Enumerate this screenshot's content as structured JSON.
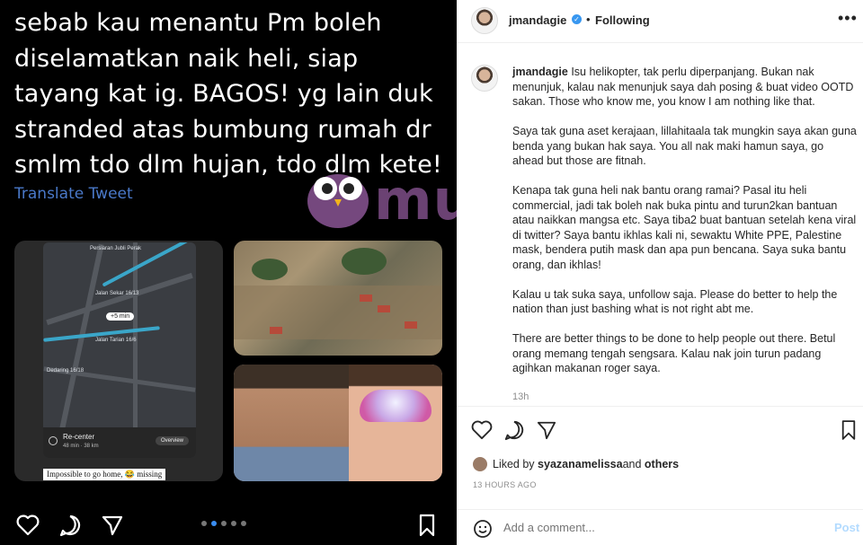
{
  "tweet": {
    "text": "sebab kau menantu Pm boleh\ndiselamatkan naik heli, siap\ntayang kat ig. BAGOS! yg lain duk\nstranded atas bumbung rumah dr\nsmlm tdo dlm hujan, tdo dlm kete!",
    "translate_label": "Translate Tweet"
  },
  "map_screen": {
    "top_label": "Persiaran Jubli Perak",
    "road_label_1": "Jalan Sekar 16/13",
    "eta_pill": "+5 min",
    "road_label_2": "Jalan Tarian 16/6",
    "road_label_3": "Dedaring 16/18",
    "recenter_title": "Re-center",
    "recenter_sub": "48 min · 38 km",
    "overview_label": "Overview",
    "caption": "Impossible to go home, 😂 missing"
  },
  "watermark": {
    "text": "murai"
  },
  "post": {
    "username": "jmandagie",
    "verified_mark": "✓",
    "separator": "•",
    "following_label": "Following",
    "more_icon": "•••",
    "caption_user": "jmandagie",
    "caption_paragraphs": [
      "Isu helikopter, tak perlu diperpanjang. Bukan nak menunjuk, kalau nak menunjuk saya dah posing & buat video OOTD sakan. Those who know me, you know I am nothing like that.",
      "Saya tak guna aset kerajaan, lillahitaala tak mungkin saya akan guna benda yang bukan hak saya. You all nak maki hamun saya, go ahead but those are fitnah.",
      "Kenapa tak guna heli nak bantu orang ramai? Pasal itu heli commercial, jadi tak boleh nak buka pintu and turun2kan bantuan atau naikkan mangsa etc. Saya tiba2 buat bantuan setelah kena viral di twitter? Saya bantu ikhlas kali ni, sewaktu White PPE, Palestine mask, bendera putih mask dan apa pun bencana. Saya suka bantu orang, dan ikhlas!",
      "Kalau u tak suka saya, unfollow saja. Please do better to help the nation than just bashing what is not right abt me.",
      "There are better things to be done to help people out there. Betul orang memang tengah sengsara. Kalau nak join turun padang agihkan makanan roger saya."
    ],
    "caption_time": "13h",
    "liked_prefix": "Liked by ",
    "liked_user": "syazanamelissa",
    "liked_suffix": " and ",
    "liked_others": "others",
    "posted_ago": "13 HOURS AGO",
    "comment_placeholder": "Add a comment...",
    "post_label": "Post"
  },
  "colors": {
    "verified_blue": "#3897f0",
    "link_blue": "#4a79c9",
    "post_disabled": "#b3dbff",
    "watermark_purple": "#c378d2"
  },
  "icons": {
    "left_bar": [
      "heart-icon",
      "comment-icon",
      "share-icon",
      "bookmark-icon"
    ],
    "right_bar": [
      "heart-icon",
      "comment-icon",
      "share-icon",
      "bookmark-icon"
    ],
    "comment_row": [
      "emoji-icon"
    ]
  },
  "carousel": {
    "count": 5,
    "active_index": 1
  }
}
